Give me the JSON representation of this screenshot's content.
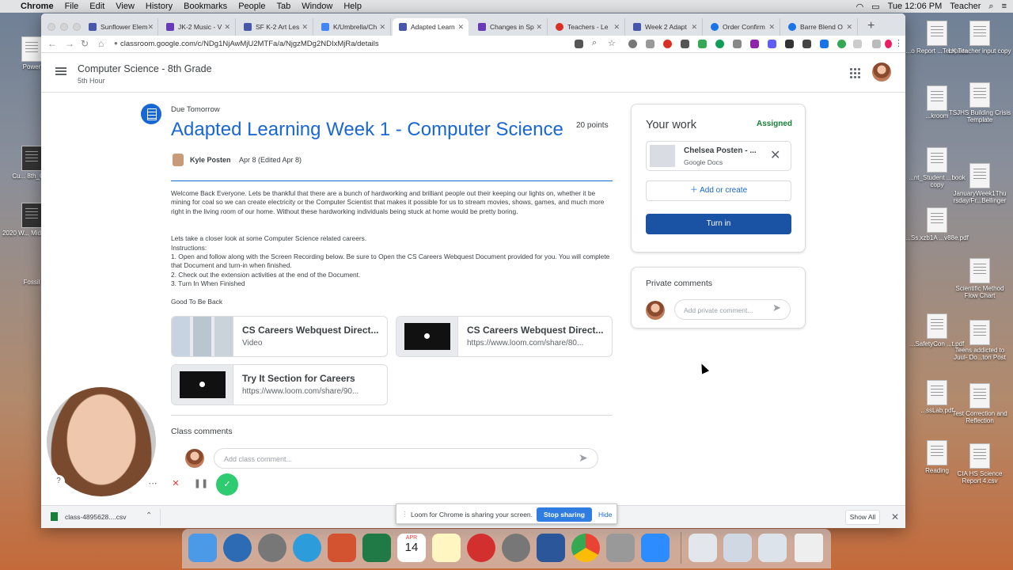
{
  "menubar": {
    "items": [
      "Chrome",
      "File",
      "Edit",
      "View",
      "History",
      "Bookmarks",
      "People",
      "Tab",
      "Window",
      "Help"
    ],
    "clock": "Tue 12:06 PM",
    "user": "Teacher"
  },
  "desktop": {
    "left_icons": [
      "Power",
      "Cu... 8th_Con",
      "2020 W... Middle S...",
      "Fossil"
    ],
    "right_icons": [
      "...o Report ...Template",
      "LK Teacher input copy",
      "...kroom",
      "TSJHS Building Crisis Template",
      "...nt_Student ...book copy",
      "JanuaryWeek1Thu rsday/Fr...Bellinger",
      "...Ss.xzb1A ...v88e.pdf",
      "Scientific Method Flow Chart",
      "...SafetyCon ...t.pdf",
      "Teens addicted to Juul- Do...ton Post",
      "...ssLab.pdf",
      "Test Correction and Reflection",
      "Reading",
      "CIA HS Science Report 4.csv"
    ]
  },
  "browser": {
    "tabs": [
      {
        "label": "Sunflower Elem",
        "color": "#4758ab"
      },
      {
        "label": "JK-2 Music - V",
        "color": "#673ab7"
      },
      {
        "label": "SF K-2 Art Les",
        "color": "#4758ab"
      },
      {
        "label": "K/Umbrella/Ch",
        "color": "#4285f4"
      },
      {
        "label": "Adapted Learn",
        "color": "#4758ab"
      },
      {
        "label": "Changes in Sp",
        "color": "#673ab7"
      },
      {
        "label": "Teachers - Le",
        "color": "#d93025"
      },
      {
        "label": "Week 2 Adapt",
        "color": "#4758ab"
      },
      {
        "label": "Order Confirm",
        "color": "#1a73e8"
      },
      {
        "label": "Barre Blend O",
        "color": "#1a73e8"
      }
    ],
    "url": "classroom.google.com/c/NDg1NjAwMjU2MTFa/a/NjgzMDg2NDIxMjRa/details"
  },
  "classroom": {
    "class_name": "Computer Science - 8th Grade",
    "class_section": "5th Hour"
  },
  "assignment": {
    "due": "Due Tomorrow",
    "title": "Adapted Learning Week 1 - Computer Science",
    "points": "20 points",
    "teacher": "Kyle Posten",
    "date": "Apr 8 (Edited Apr 8)",
    "paragraph1": "Welcome Back Everyone. Lets be thankful that there are a bunch of hardworking and brilliant people out their keeping our lights on, whether it be mining for coal so we can create electricity or the Computer Scientist that makes it possible for us to stream movies, shows, games, and much more right in the living room of our home. Without these hardworking individuals being stuck at home would be pretty boring.",
    "lines": [
      "Lets take a closer look at some Computer Science related careers.",
      "Instructions:",
      "1. Open and follow along with the Screen Recording below. Be sure to Open the CS Careers Webquest Document provided for you. You will complete that Document and turn-in when finished.",
      "2. Check out the extension activities at the end of the Document.",
      "3. Turn In When Finished"
    ],
    "closing": "Good To Be Back",
    "attachments": [
      {
        "title": "CS Careers Webquest Direct...",
        "subtitle": "Video"
      },
      {
        "title": "CS Careers Webquest Direct...",
        "subtitle": "https://www.loom.com/share/80..."
      },
      {
        "title": "Try It Section for Careers",
        "subtitle": "https://www.loom.com/share/90..."
      }
    ],
    "class_comments_label": "Class comments",
    "class_comment_placeholder": "Add class comment..."
  },
  "your_work": {
    "title": "Your work",
    "status": "Assigned",
    "file_name": "Chelsea Posten - ...",
    "file_type": "Google Docs",
    "add_label": "Add or create",
    "turn_in_label": "Turn in"
  },
  "private_comments": {
    "title": "Private comments",
    "placeholder": "Add private comment..."
  },
  "downloads": {
    "file": "class-4895628....csv",
    "show_all": "Show All"
  },
  "loom": {
    "message": "Loom for Chrome is sharing your screen.",
    "stop": "Stop sharing",
    "hide": "Hide"
  },
  "dock": {
    "date_badge_month": "APR",
    "date_badge_day": "14"
  },
  "colors": {
    "accent": "#1967d2",
    "assigned": "#188038",
    "turn_in": "#1a53a3"
  }
}
